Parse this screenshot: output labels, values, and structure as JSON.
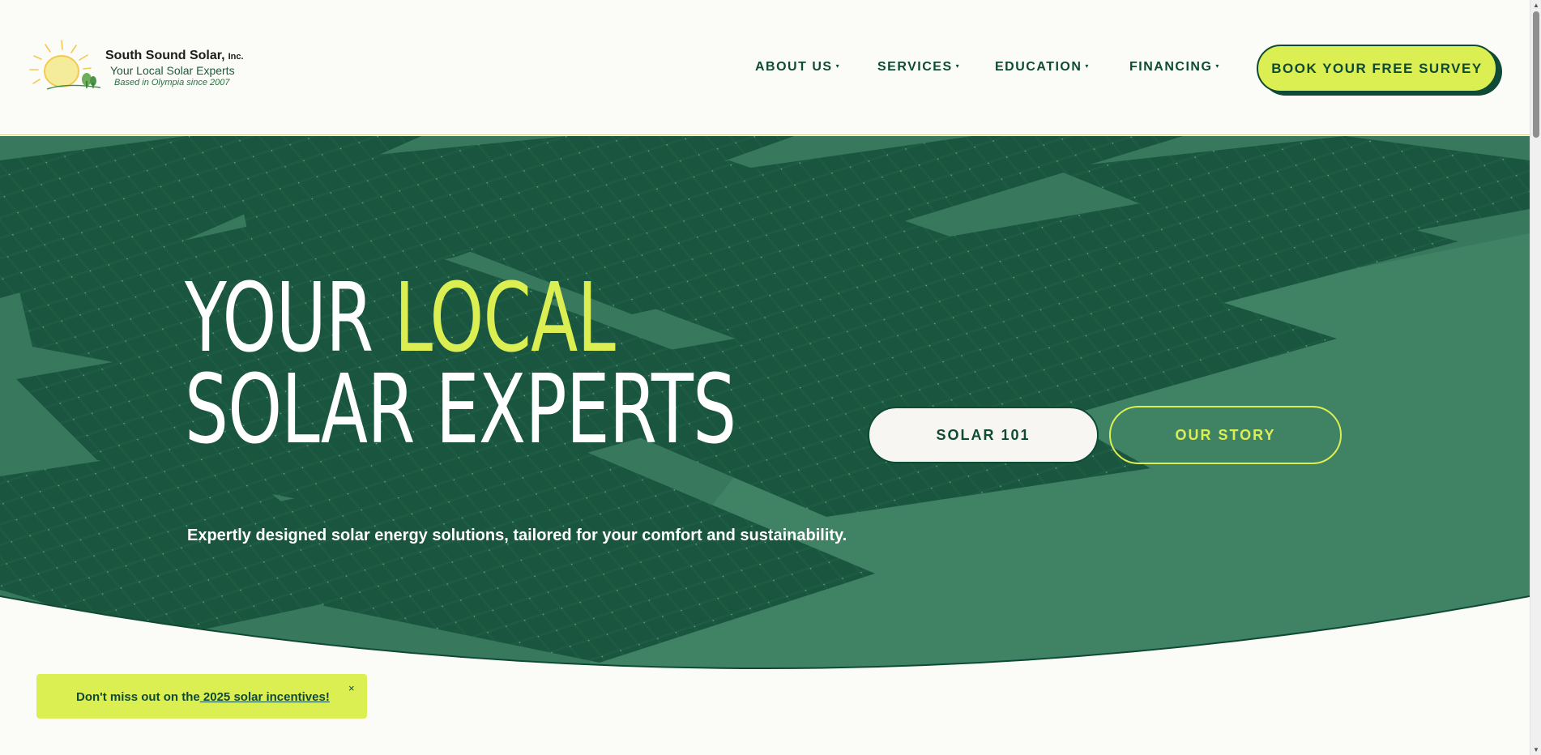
{
  "colors": {
    "brand_green": "#0e4a36",
    "accent_lime": "#dcef52",
    "page_background": "#fbfcf7",
    "hero_overlay": "#2d7256"
  },
  "header": {
    "logo": {
      "name": "South Sound Solar,",
      "suffix": "Inc.",
      "tagline": "Your Local Solar Experts",
      "since": "Based in Olympia since 2007",
      "icon": "sun-with-trees-icon"
    },
    "nav": [
      {
        "label": "ABOUT US",
        "icon": "caret-down-icon"
      },
      {
        "label": "SERVICES",
        "icon": "caret-down-icon"
      },
      {
        "label": "EDUCATION",
        "icon": "caret-down-icon"
      },
      {
        "label": "FINANCING",
        "icon": "caret-down-icon"
      }
    ],
    "cta_label": "BOOK YOUR FREE SURVEY"
  },
  "hero": {
    "title_part1": "YOUR ",
    "title_accent": "LOCAL",
    "title_line2": "SOLAR EXPERTS",
    "subtitle": "Expertly designed solar energy solutions, tailored for your comfort and sustainability.",
    "primary_button": "SOLAR 101",
    "secondary_button": "OUR STORY",
    "background_image": "solar-panels-photo"
  },
  "notice": {
    "text_before": "Don't miss out on the",
    "link_text": " 2025 solar incentives!",
    "close_symbol": "×"
  },
  "glyphs": {
    "caret": "▾",
    "scroll_up": "▲",
    "scroll_down": "▼"
  }
}
